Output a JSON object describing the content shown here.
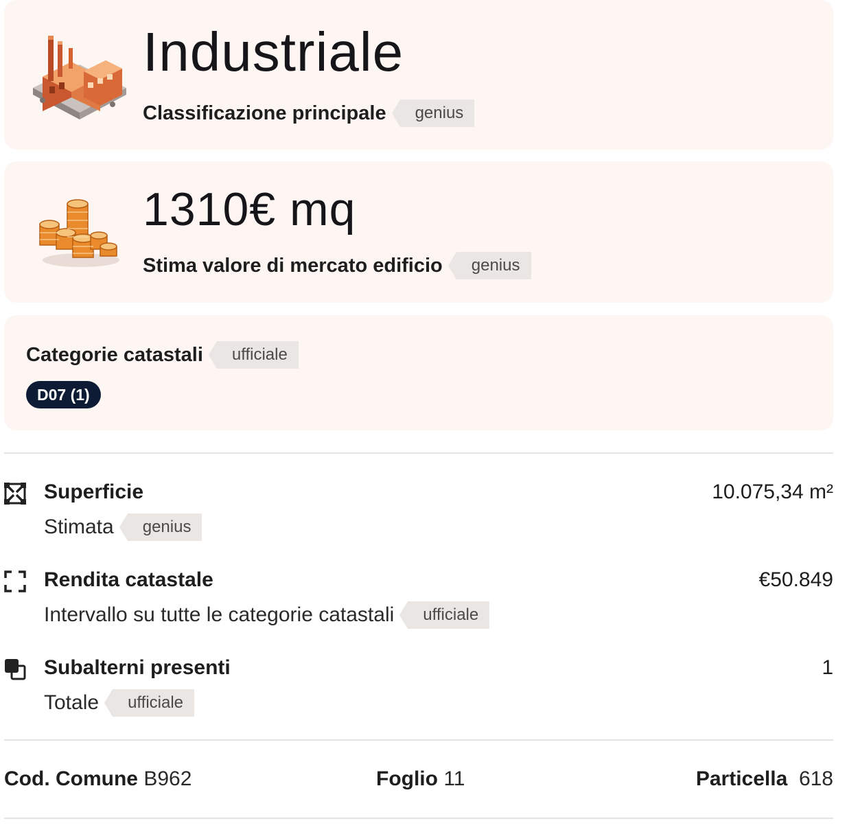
{
  "classification": {
    "title": "Industriale",
    "label": "Classificazione principale",
    "tag": "genius"
  },
  "market_value": {
    "title": "1310€ mq",
    "label": "Stima valore di mercato edificio",
    "tag": "genius"
  },
  "cadastral_categories": {
    "label": "Categorie catastali",
    "tag": "ufficiale",
    "items": [
      "D07 (1)"
    ]
  },
  "details": [
    {
      "icon": "resize-arrows-icon",
      "title": "Superficie",
      "subtitle": "Stimata",
      "tag": "genius",
      "value": "10.075,34 m²"
    },
    {
      "icon": "expand-corners-icon",
      "title": "Rendita catastale",
      "subtitle": "Intervallo su tutte le categorie catastali",
      "tag": "ufficiale",
      "value": "€50.849"
    },
    {
      "icon": "layers-copy-icon",
      "title": "Subalterni presenti",
      "subtitle": "Totale",
      "tag": "ufficiale",
      "value": "1"
    }
  ],
  "footer": {
    "comune_label": "Cod. Comune",
    "comune_value": "B962",
    "foglio_label": "Foglio",
    "foglio_value": "11",
    "particella_label": "Particella",
    "particella_value": "618"
  }
}
